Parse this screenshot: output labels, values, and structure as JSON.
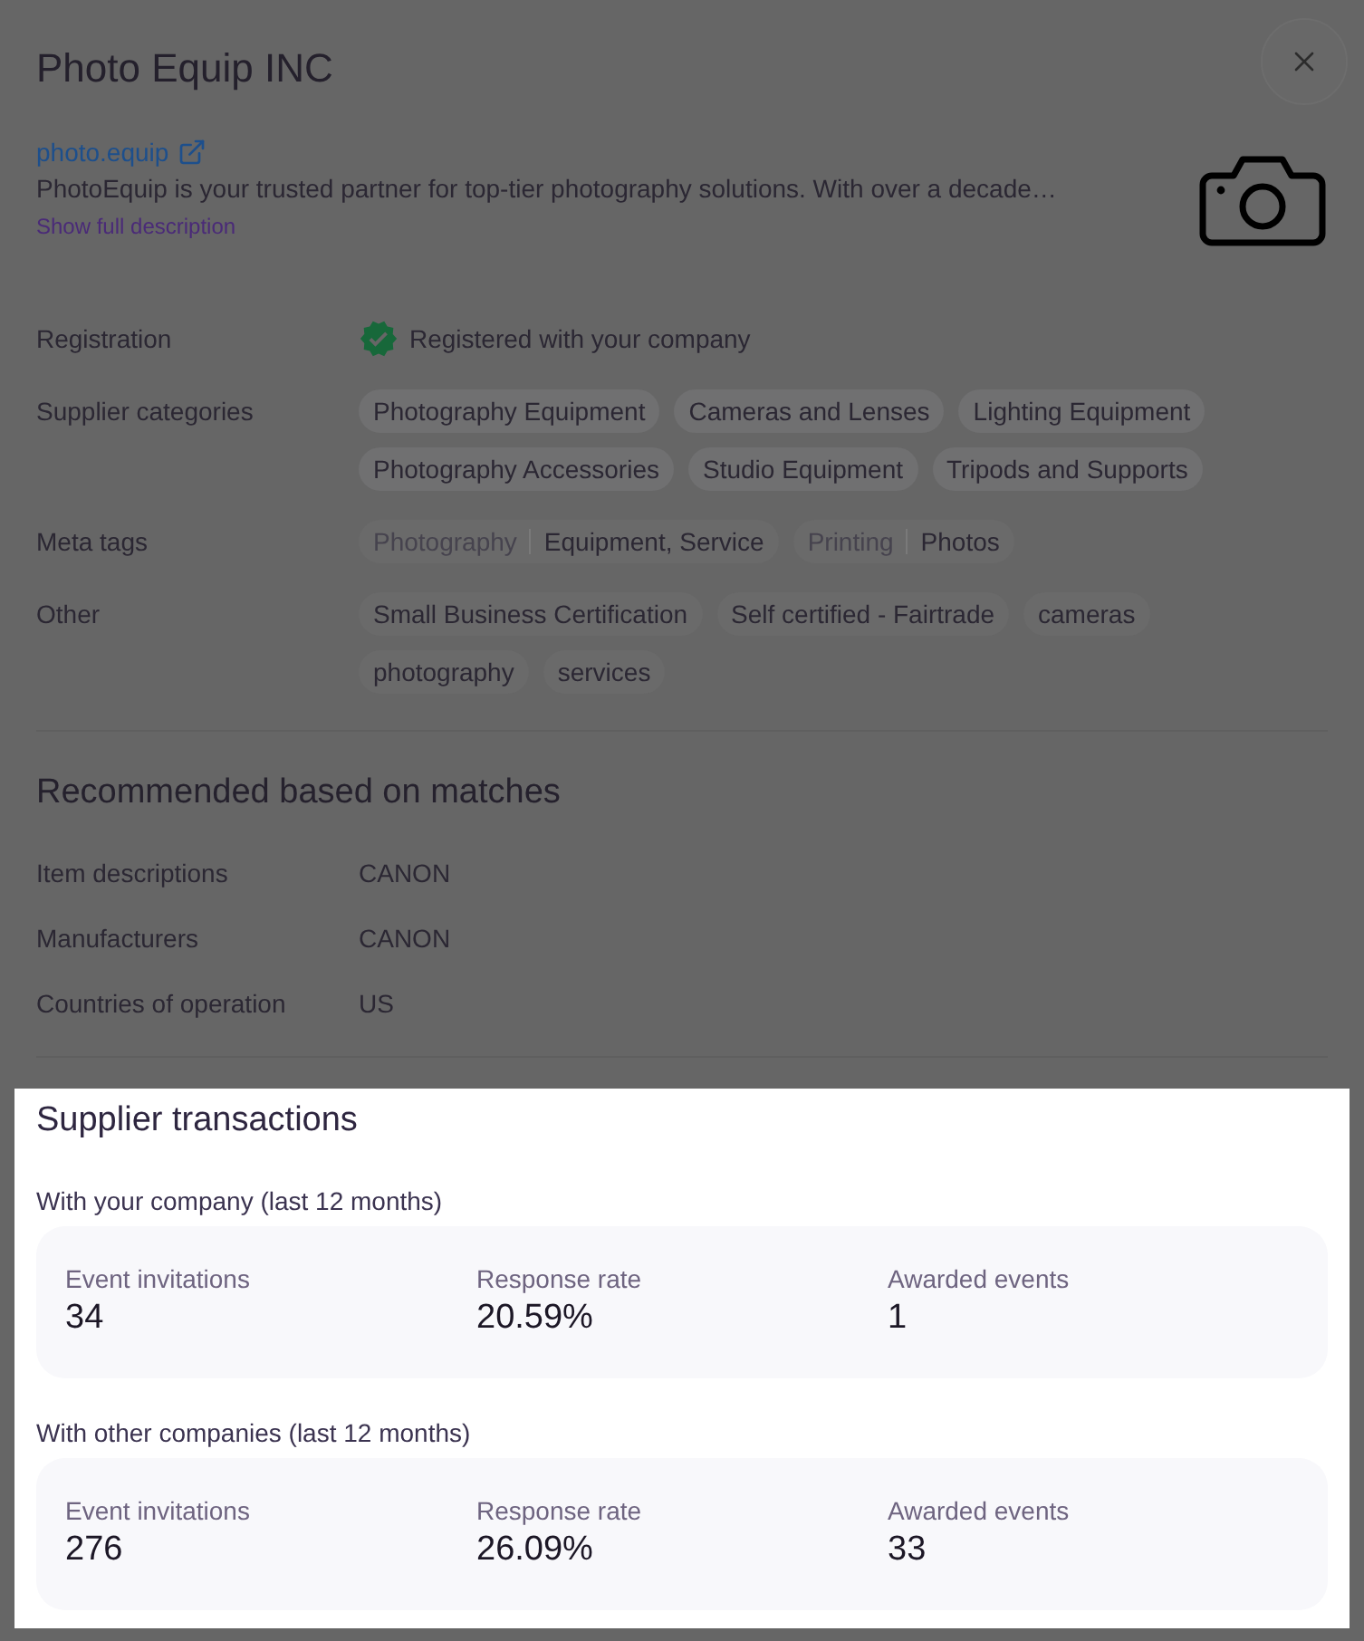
{
  "modal": {
    "title": "Photo Equip INC",
    "website": "photo.equip",
    "description": "PhotoEquip is your trusted partner for top-tier photography solutions. With over a decade…",
    "show_description": "Show full description"
  },
  "details": [
    {
      "kind": "status",
      "label": "Registration",
      "value": "Registered with your company",
      "verified": true
    },
    {
      "kind": "chips",
      "label": "Supplier categories",
      "chips": [
        "Photography Equipment",
        "Cameras and Lenses",
        "Lighting Equipment",
        "Photography Accessories",
        "Studio Equipment",
        "Tripods and Supports"
      ]
    },
    {
      "kind": "pairs",
      "label": "Meta tags",
      "tags": [
        {
          "category": "Photography",
          "value": "Equipment, Service"
        },
        {
          "category": "Printing",
          "value": "Photos"
        }
      ]
    },
    {
      "kind": "tags",
      "label": "Other",
      "chips": [
        "Small Business Certification",
        "Self certified - Fairtrade",
        "cameras",
        "photography",
        "services"
      ]
    }
  ],
  "recommended": {
    "title": "Recommended based on matches",
    "rows": [
      {
        "label": "Item descriptions",
        "value": "CANON"
      },
      {
        "label": "Manufacturers",
        "value": "CANON"
      },
      {
        "label": "Countries of operation",
        "value": "US"
      }
    ]
  },
  "transactions": {
    "title": "Supplier transactions",
    "spotlight": true,
    "groups": [
      {
        "title": "With your company (last 12 months)",
        "stats": [
          {
            "label": "Event invitations",
            "value": "34"
          },
          {
            "label": "Response rate",
            "value": "20.59%"
          },
          {
            "label": "Awarded events",
            "value": "1"
          }
        ]
      },
      {
        "title": "With other companies (last 12 months)",
        "stats": [
          {
            "label": "Event invitations",
            "value": "276"
          },
          {
            "label": "Response rate",
            "value": "26.09%"
          },
          {
            "label": "Awarded events",
            "value": "33"
          }
        ]
      }
    ]
  }
}
